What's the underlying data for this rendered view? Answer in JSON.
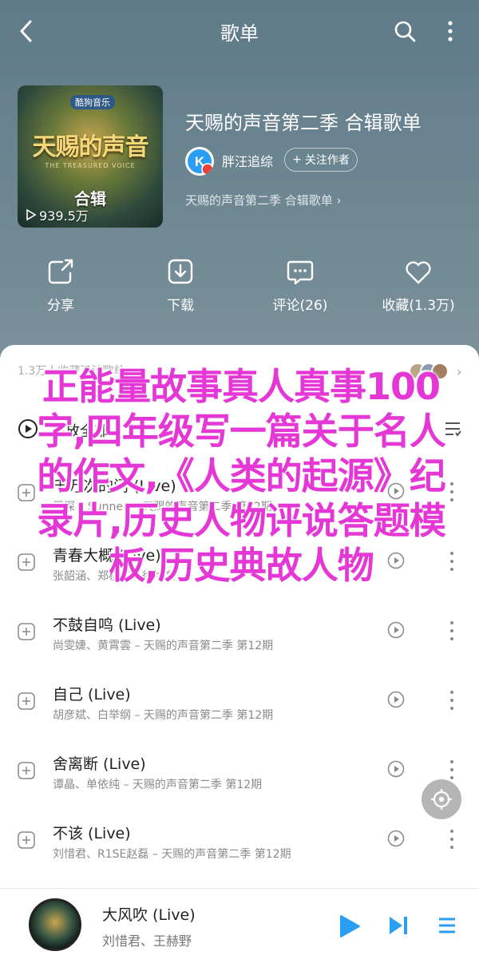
{
  "topbar": {
    "title": "歌单"
  },
  "playlist": {
    "cover_brand": "酷狗音乐",
    "cover_logo": "天赐的声音",
    "cover_sub": "THE TREASURED VOICE",
    "cover_tag": "合辑",
    "cover_plays": "939.5万",
    "title": "天赐的声音第二季 合辑歌单",
    "creator": {
      "name": "胖汪追综",
      "follow_label": "关注作者"
    },
    "description": "天赐的声音第二季 合辑歌单 ›"
  },
  "actions": [
    {
      "label": "分享",
      "icon": "share-icon"
    },
    {
      "label": "下载",
      "icon": "download-icon"
    },
    {
      "label": "评论(26)",
      "icon": "comment-icon"
    },
    {
      "label": "收藏(1.3万)",
      "icon": "heart-icon"
    }
  ],
  "list": {
    "update_text": "1.3万人收藏了该歌单",
    "play_all": "播放全部",
    "songs": [
      {
        "title": "千万次的问 (Live)",
        "sub": "周深 – Sunnee – 天赐的声音第二季 第12期"
      },
      {
        "title": "青春大概 (Live)",
        "sub": "张韶涵、郑棋元、徐均朔"
      },
      {
        "title": "不鼓自鸣 (Live)",
        "sub": "尚雯婕、黄霄雲 – 天赐的声音第二季 第12期"
      },
      {
        "title": "自己 (Live)",
        "sub": "胡彦斌、白举纲 – 天赐的声音第二季 第12期"
      },
      {
        "title": "舍离断 (Live)",
        "sub": "谭晶、单依纯 – 天赐的声音第二季 第12期"
      },
      {
        "title": "不该 (Live)",
        "sub": "刘惜君、R1SE赵磊 – 天赐的声音第二季 第12期"
      }
    ]
  },
  "player": {
    "title": "大风吹 (Live)",
    "artist": "刘惜君、王赫野"
  },
  "overlay_text": "正能量故事真人真事100字,四年级写一篇关于名人的作文,《人类的起源》纪录片,历史人物评说答题模板,历史典故人物",
  "colors": {
    "accent": "#2a9df4",
    "overlay": "#e536d6",
    "header": "#6f8794"
  }
}
